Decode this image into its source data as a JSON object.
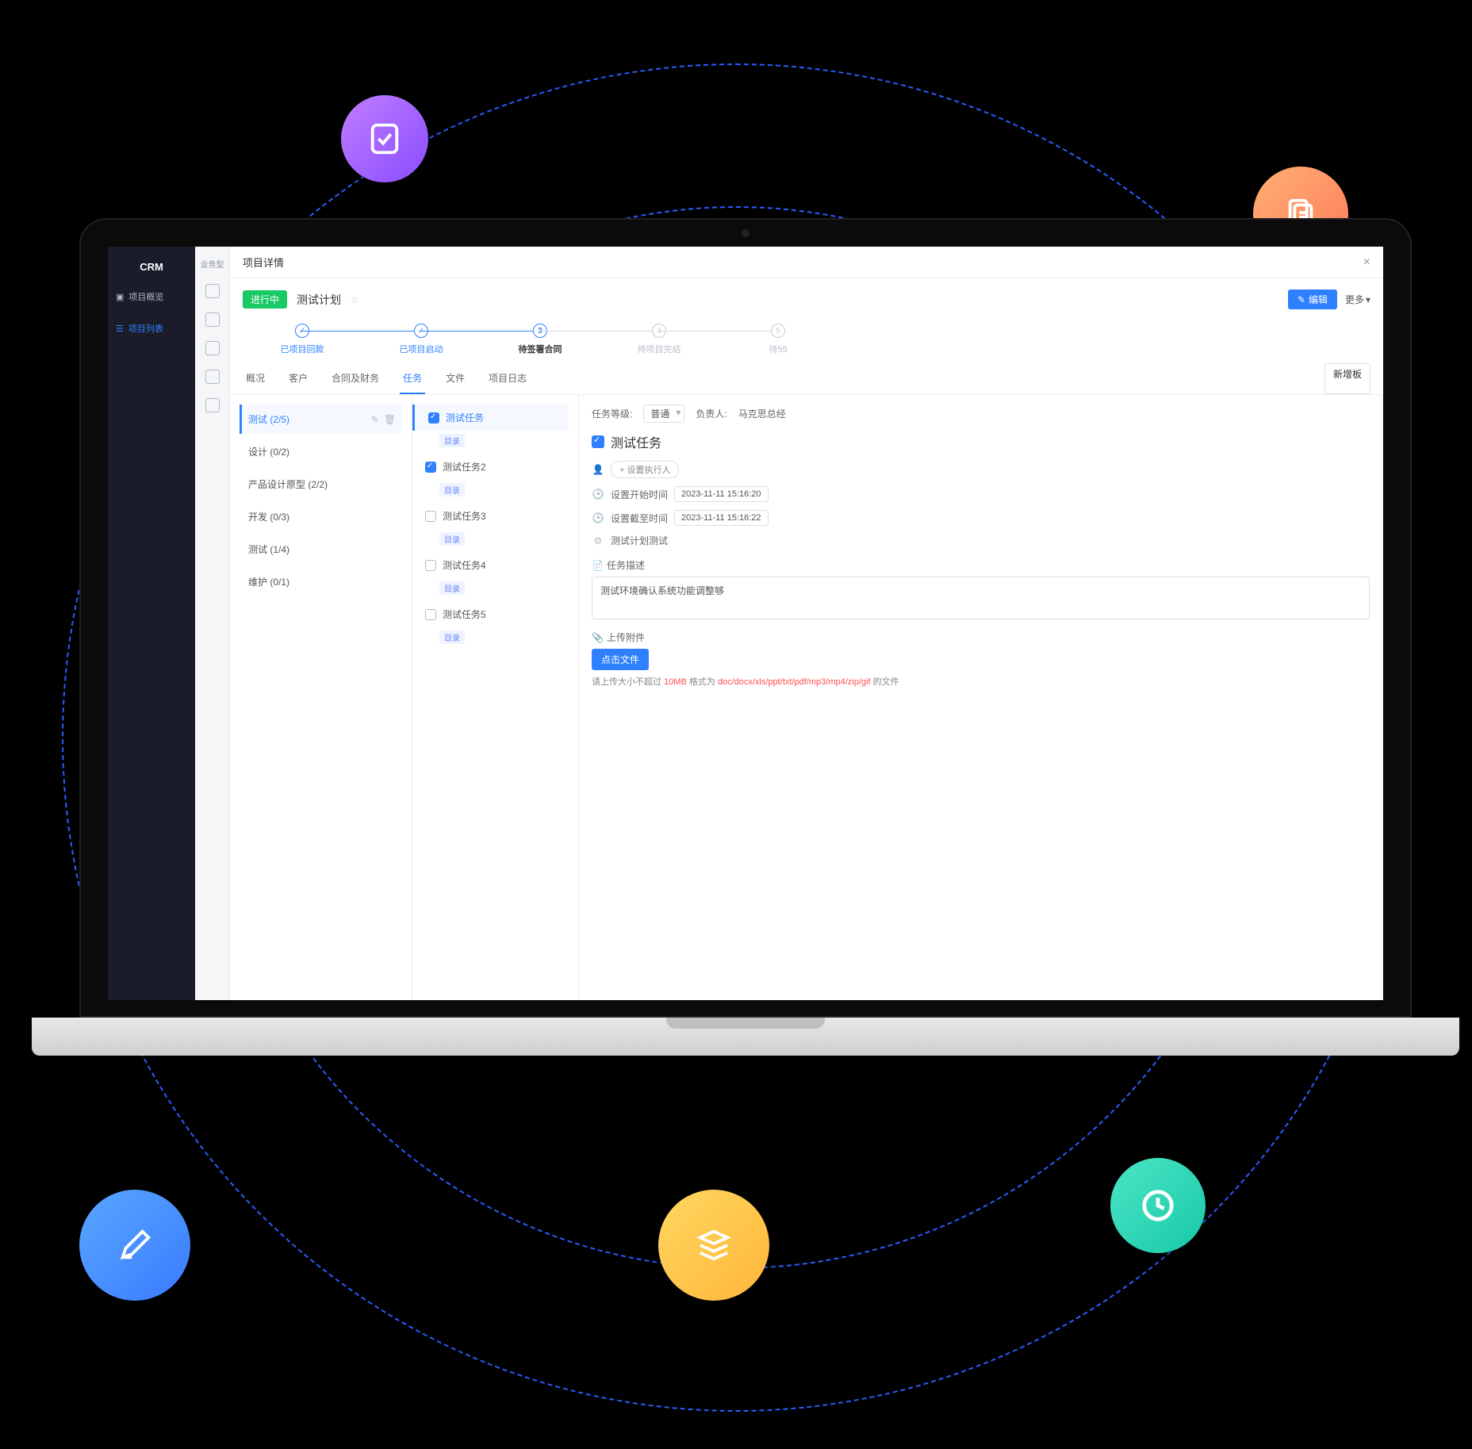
{
  "nav": {
    "brand": "CRM",
    "items": [
      {
        "label": "项目概览"
      },
      {
        "label": "项目列表",
        "active": true
      }
    ]
  },
  "rail_tip": "业务型",
  "modal_title": "项目详情",
  "status": {
    "pill": "进行中",
    "title": "测试计划"
  },
  "actions": {
    "edit": "编辑",
    "more": "更多"
  },
  "steps": [
    {
      "n": "1",
      "label": "已项目回款",
      "state": "done"
    },
    {
      "n": "2",
      "label": "已项目启动",
      "state": "done"
    },
    {
      "n": "3",
      "label": "待签署合同",
      "state": "cur"
    },
    {
      "n": "4",
      "label": "待项目完结",
      "state": "future"
    },
    {
      "n": "5",
      "label": "待55",
      "state": "future"
    }
  ],
  "tabs": [
    "概况",
    "客户",
    "合同及财务",
    "任务",
    "文件",
    "项目日志"
  ],
  "active_tab": "任务",
  "new_board": "新增板",
  "groups": [
    {
      "label": "测试",
      "count": "(2/5)",
      "active": true
    },
    {
      "label": "设计",
      "count": "(0/2)"
    },
    {
      "label": "产品设计原型",
      "count": "(2/2)"
    },
    {
      "label": "开发",
      "count": "(0/3)"
    },
    {
      "label": "测试",
      "count": "(1/4)"
    },
    {
      "label": "维护",
      "count": "(0/1)"
    }
  ],
  "tasks": [
    {
      "label": "测试任务",
      "checked": true,
      "tag": "目录",
      "active": true
    },
    {
      "label": "测试任务2",
      "checked": true,
      "tag": "目录"
    },
    {
      "label": "测试任务3",
      "checked": false,
      "tag": "目录"
    },
    {
      "label": "测试任务4",
      "checked": false,
      "tag": "目录"
    },
    {
      "label": "测试任务5",
      "checked": false,
      "tag": "目录"
    }
  ],
  "detail": {
    "urgency_label": "任务等级:",
    "urgency_value": "普通",
    "owner_label": "负责人:",
    "owner_value": "马克思总经",
    "title": "测试任务",
    "assistant_label": "+ 设置执行人",
    "start_label": "设置开始时间",
    "start_value": "2023-11-11 15:16:20",
    "end_label": "设置截至时间",
    "end_value": "2023-11-11 15:16:22",
    "plan_label": "测试计划测试",
    "desc_label": "任务描述",
    "desc_value": "测试环境确认系统功能调整够",
    "attach_label": "上传附件",
    "upload_btn": "点击文件",
    "hint_pre": "请上传大小不超过 ",
    "hint_size": "10MB",
    "hint_mid": " 格式为 ",
    "hint_fmt": "doc/docx/xls/ppt/txt/pdf/mp3/mp4/zip/gif",
    "hint_suf": " 的文件"
  }
}
